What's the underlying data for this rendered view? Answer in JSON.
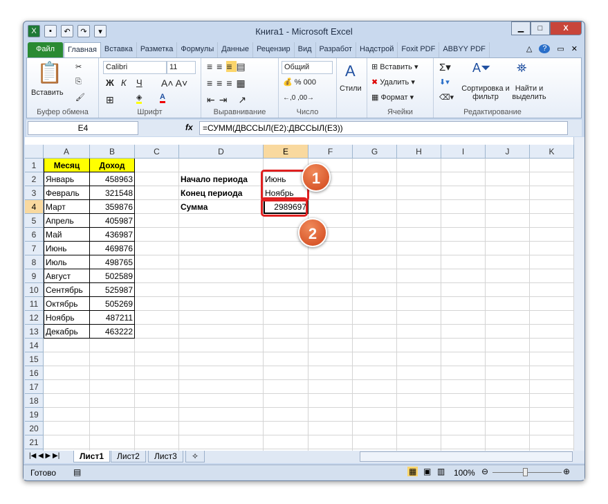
{
  "title": "Книга1  -  Microsoft Excel",
  "tabs": [
    "Файл",
    "Главная",
    "Вставка",
    "Разметка",
    "Формулы",
    "Данные",
    "Рецензир",
    "Вид",
    "Разработ",
    "Надстрой",
    "Foxit PDF",
    "ABBYY PDF"
  ],
  "ribbon": {
    "paste": "Вставить",
    "clipboard": "Буфер обмена",
    "font_name": "Calibri",
    "font_size": "11",
    "bold": "Ж",
    "italic": "К",
    "underline": "Ч",
    "font": "Шрифт",
    "alignment": "Выравнивание",
    "number_format": "Общий",
    "number": "Число",
    "styles": "Стили",
    "insert": "Вставить",
    "delete": "Удалить",
    "format": "Формат",
    "cells": "Ячейки",
    "sort": "Сортировка и фильтр",
    "find": "Найти и выделить",
    "editing": "Редактирование"
  },
  "name_box": "E4",
  "formula": "=СУММ(ДВССЫЛ(E2):ДВССЫЛ(E3))",
  "columns": [
    "A",
    "B",
    "C",
    "D",
    "E",
    "F",
    "G",
    "H",
    "I",
    "J",
    "K"
  ],
  "rows": 22,
  "table": {
    "headers": [
      "Месяц",
      "Доход"
    ],
    "months": [
      "Январь",
      "Февраль",
      "Март",
      "Апрель",
      "Май",
      "Июнь",
      "Июль",
      "Август",
      "Сентябрь",
      "Октябрь",
      "Ноябрь",
      "Декабрь"
    ],
    "values": [
      "458963",
      "321548",
      "359876",
      "405987",
      "436987",
      "469876",
      "498765",
      "502589",
      "525987",
      "505269",
      "487211",
      "463222"
    ]
  },
  "labels": {
    "start": "Начало периода",
    "end": "Конец периода",
    "sum": "Сумма",
    "start_val": "Июнь",
    "end_val": "Ноябрь",
    "sum_val": "2989697"
  },
  "callouts": [
    "1",
    "2"
  ],
  "sheets": [
    "Лист1",
    "Лист2",
    "Лист3"
  ],
  "status": "Готово",
  "zoom": "100%"
}
